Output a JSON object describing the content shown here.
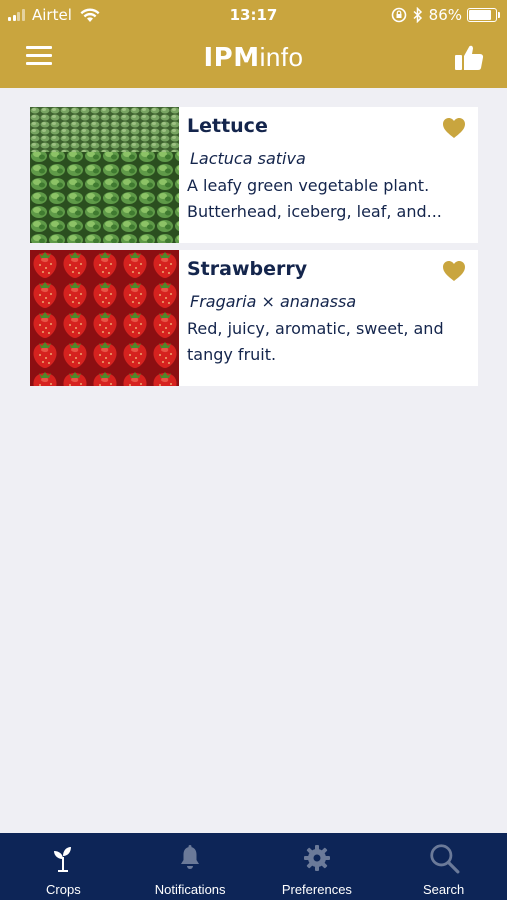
{
  "status_bar": {
    "carrier": "Airtel",
    "time": "13:17",
    "battery": "86%",
    "battery_level": 0.86
  },
  "nav": {
    "logo_bold": "IPM",
    "logo_light": "info",
    "menu_icon": "hamburger-icon",
    "action_icon": "thumbs-up-icon"
  },
  "crops": [
    {
      "name": "Lettuce",
      "scientific_name": "Lactuca sativa",
      "description": "A leafy green vegetable plant. Butterhead, iceberg, leaf, and...",
      "image": "lettuce-field-photo",
      "favorite_icon": "heart-icon"
    },
    {
      "name": "Strawberry",
      "scientific_name": "Fragaria × ananassa",
      "description": "Red, juicy, aromatic, sweet, and tangy fruit.",
      "image": "strawberries-photo",
      "favorite_icon": "heart-icon"
    }
  ],
  "tabs": [
    {
      "label": "Crops",
      "icon": "sprout-icon",
      "active": true
    },
    {
      "label": "Notifications",
      "icon": "bell-icon",
      "active": false
    },
    {
      "label": "Preferences",
      "icon": "gear-icon",
      "active": false
    },
    {
      "label": "Search",
      "icon": "search-icon",
      "active": false
    }
  ],
  "colors": {
    "brand_gold": "#c9a53e",
    "navy": "#0d2557",
    "text_navy": "#14254c",
    "background": "#efeff4",
    "inactive_tab_icon": "#6b7a99"
  }
}
